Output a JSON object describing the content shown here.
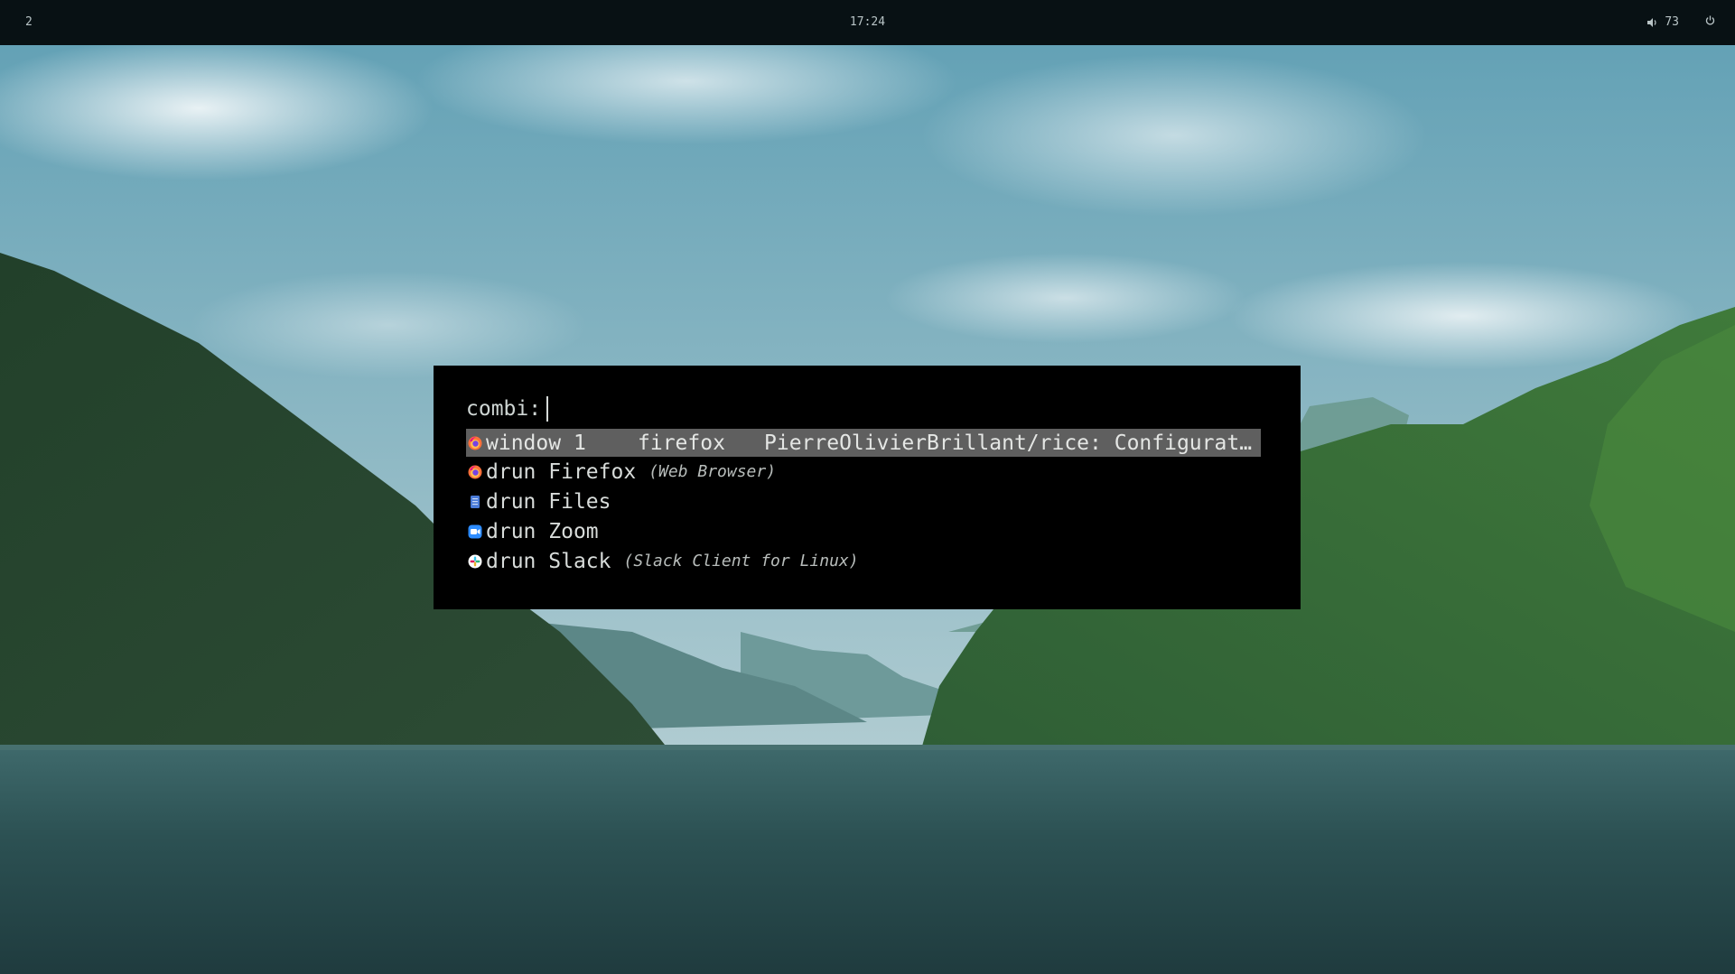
{
  "topbar": {
    "workspace": "2",
    "clock": "17:24",
    "volume_level": "73",
    "volume_icon": "speaker-icon",
    "power_icon": "power-icon"
  },
  "launcher": {
    "prompt": "combi:",
    "input_value": "",
    "entries": [
      {
        "icon": "firefox-icon",
        "mode": "window",
        "number": "1",
        "app": "firefox",
        "title": "PierreOlivierBrillant/rice: Configurat…",
        "selected": true
      },
      {
        "icon": "firefox-icon",
        "mode": "drun",
        "name": "Firefox",
        "comment": "(Web Browser)"
      },
      {
        "icon": "files-icon",
        "mode": "drun",
        "name": "Files",
        "comment": ""
      },
      {
        "icon": "zoom-icon",
        "mode": "drun",
        "name": "Zoom",
        "comment": ""
      },
      {
        "icon": "slack-icon",
        "mode": "drun",
        "name": "Slack",
        "comment": "(Slack Client for Linux)"
      }
    ]
  },
  "colors": {
    "bar_bg": "#081114",
    "launcher_bg": "#000000",
    "selection_bg": "#5f5f5f",
    "text": "#d6dbd9"
  }
}
